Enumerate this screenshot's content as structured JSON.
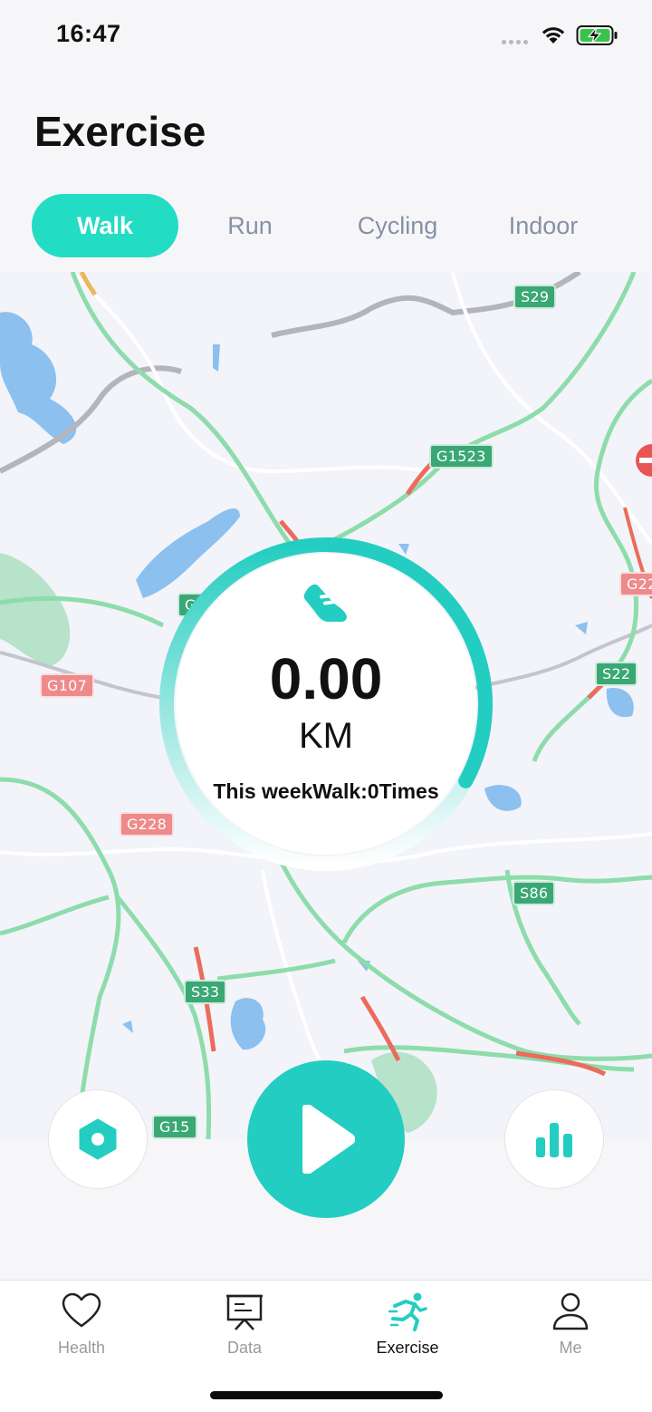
{
  "status_bar": {
    "time": "16:47"
  },
  "page": {
    "title": "Exercise"
  },
  "tabs": [
    {
      "label": "Walk",
      "active": true
    },
    {
      "label": "Run",
      "active": false
    },
    {
      "label": "Cycling",
      "active": false
    },
    {
      "label": "Indoor",
      "active": false
    }
  ],
  "map": {
    "road_labels": [
      "S29",
      "G1523",
      "G22",
      "S22",
      "G107",
      "G228",
      "S86",
      "S33",
      "G15",
      "G"
    ]
  },
  "distance": {
    "value": "0.00",
    "unit": "KM",
    "week_summary": "This weekWalk:0Times",
    "ring_progress": 0.33
  },
  "controls": {
    "settings_icon": "hexagon-icon",
    "start_icon": "play-icon",
    "stats_icon": "bar-chart-icon"
  },
  "nav": [
    {
      "label": "Health",
      "icon": "heart-icon",
      "active": false
    },
    {
      "label": "Data",
      "icon": "board-icon",
      "active": false
    },
    {
      "label": "Exercise",
      "icon": "runner-icon",
      "active": true
    },
    {
      "label": "Me",
      "icon": "person-icon",
      "active": false
    }
  ],
  "colors": {
    "accent": "#23dcc4",
    "start": "#23cdc1",
    "inactive_tab": "#8790a6"
  }
}
